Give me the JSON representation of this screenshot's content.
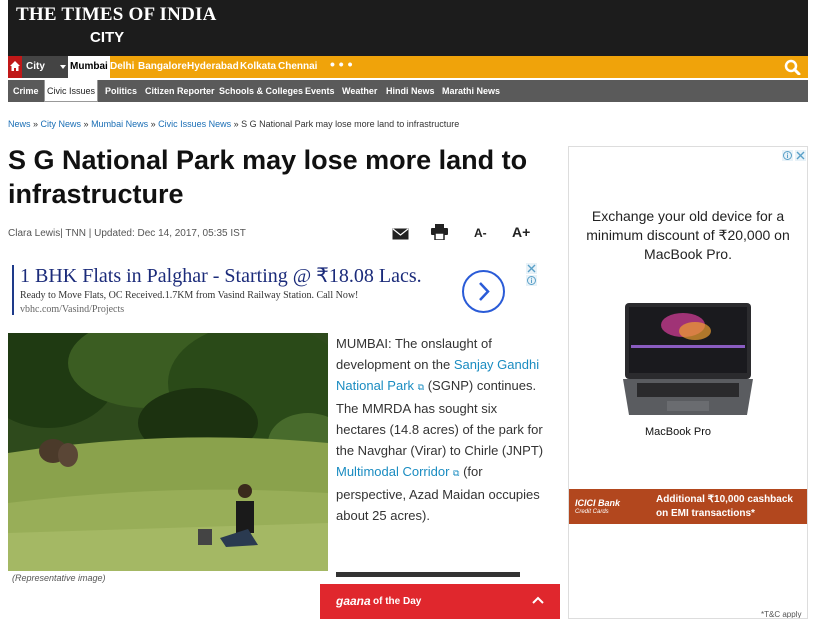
{
  "header": {
    "logo": "THE TIMES OF INDIA",
    "section": "CITY"
  },
  "nav_primary": {
    "city_label": "City",
    "cities": [
      "Mumbai",
      "Delhi",
      "Bangalore",
      "Hyderabad",
      "Kolkata",
      "Chennai"
    ],
    "active_city": "Mumbai",
    "more": "• • •"
  },
  "nav_secondary": {
    "tabs": [
      "Crime",
      "Civic Issues",
      "Politics",
      "Citizen Reporter",
      "Schools & Colleges",
      "Events",
      "Weather",
      "Hindi News",
      "Marathi News"
    ],
    "active_tab": "Civic Issues"
  },
  "breadcrumb": [
    "News",
    "City News",
    "Mumbai News",
    "Civic Issues News",
    "S G National Park may lose more land to infrastructure"
  ],
  "article": {
    "headline": "S G National Park may lose more land to infrastructure",
    "byline": "Clara Lewis| TNN | Updated: Dec 14, 2017, 05:35 IST",
    "font_decrease": "A-",
    "font_increase": "A+",
    "image_caption": "(Representative image)",
    "body_intro": "MUMBAI: The onslaught of development on the ",
    "link1": "Sanjay Gandhi National Park",
    "body_mid": " (SGNP) continues. The MMRDA has sought six hectares (14.8 acres) of the park for the Navghar (Virar) to Chirle (JNPT) ",
    "link2": "Multimodal Corridor",
    "body_end": " (for perspective, Azad Maidan occupies about 25 acres)."
  },
  "ad_text": {
    "title": "1 BHK Flats in Palghar - Starting @ ₹18.08 Lacs.",
    "description": "Ready to Move Flats, OC Received.1.7KM from Vasind Railway Station. Call Now!",
    "url": "vbhc.com/Vasind/Projects"
  },
  "ad_display": {
    "text": "Exchange your old device for a minimum discount of ₹20,000 on MacBook Pro.",
    "product_label": "MacBook Pro",
    "bank_name": "ICICI Bank",
    "bank_sub": "Credit Cards",
    "offer_line1": "Additional ₹10,000 cashback",
    "offer_line2": "on EMI transactions*",
    "disclaimer": "*T&C apply"
  },
  "gaana": {
    "logo": "gaana",
    "title": "of the Day"
  },
  "colors": {
    "nav_orange": "#f0a30a",
    "nav_gray": "#5a5a5a",
    "masthead": "#1c1c1c",
    "link_blue": "#1a8cc1",
    "gaana_red": "#e0272d",
    "icici_orange": "#b2471e"
  }
}
